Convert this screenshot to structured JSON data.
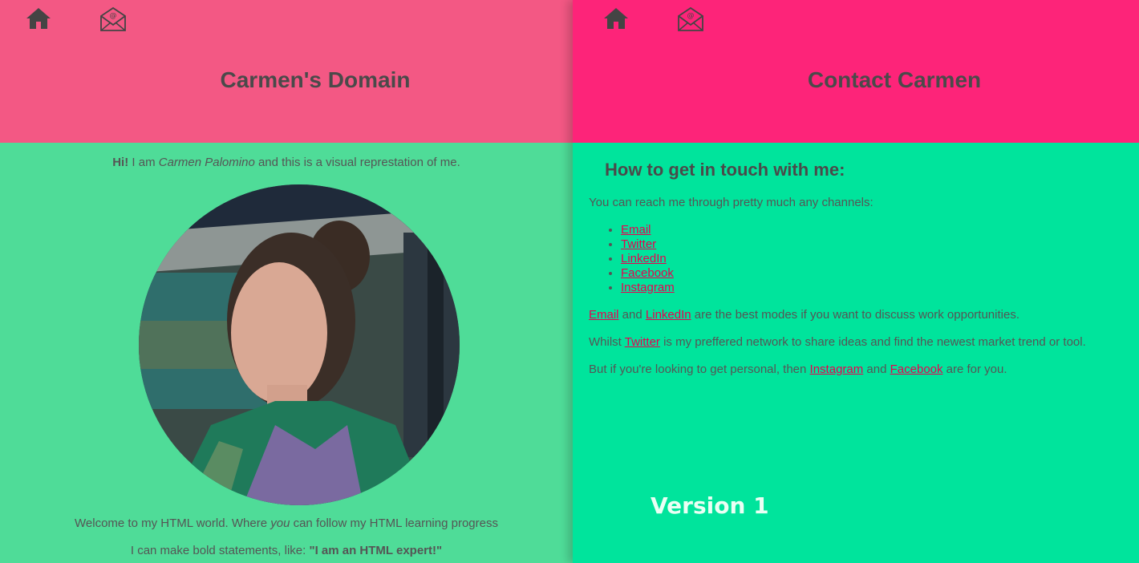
{
  "left": {
    "title": "Carmen's Domain",
    "intro": {
      "greeting": "Hi!",
      "pre": " I am ",
      "name": "Carmen Palomino",
      "post": " and this is a visual represtation of me."
    },
    "welcome": {
      "pre": "Welcome to my HTML world. Where ",
      "em": "you",
      "post": " can follow my HTML learning progress"
    },
    "statement": {
      "pre": "I can make bold statements, like: ",
      "bold": "\"I am an HTML expert!\""
    }
  },
  "right": {
    "title": "Contact Carmen",
    "heading": "How to get in touch with me:",
    "lead": "You can reach me through pretty much any channels:",
    "channels": [
      "Email",
      "Twitter",
      "LinkedIn",
      "Facebook",
      "Instagram"
    ],
    "note1": {
      "link1": "Email",
      "mid": " and ",
      "link2": "LinkedIn",
      "post": " are the best modes if you want to discuss work opportunities."
    },
    "note2": {
      "pre": "Whilst ",
      "link": "Twitter",
      "post": " is my preffered network to share ideas and find the newest market trend or tool."
    },
    "note3": {
      "pre": "But if you're looking to get personal, then ",
      "link1": "Instagram",
      "mid": " and ",
      "link2": "Facebook",
      "post": " are for you."
    },
    "version": "Version 1"
  },
  "colors": {
    "left_header": "#f35884",
    "right_header": "#fd2479",
    "left_body": "#4fdc98",
    "right_body": "#00e49c",
    "link": "#e8004f"
  },
  "icons": [
    "home-icon",
    "mail-icon"
  ]
}
